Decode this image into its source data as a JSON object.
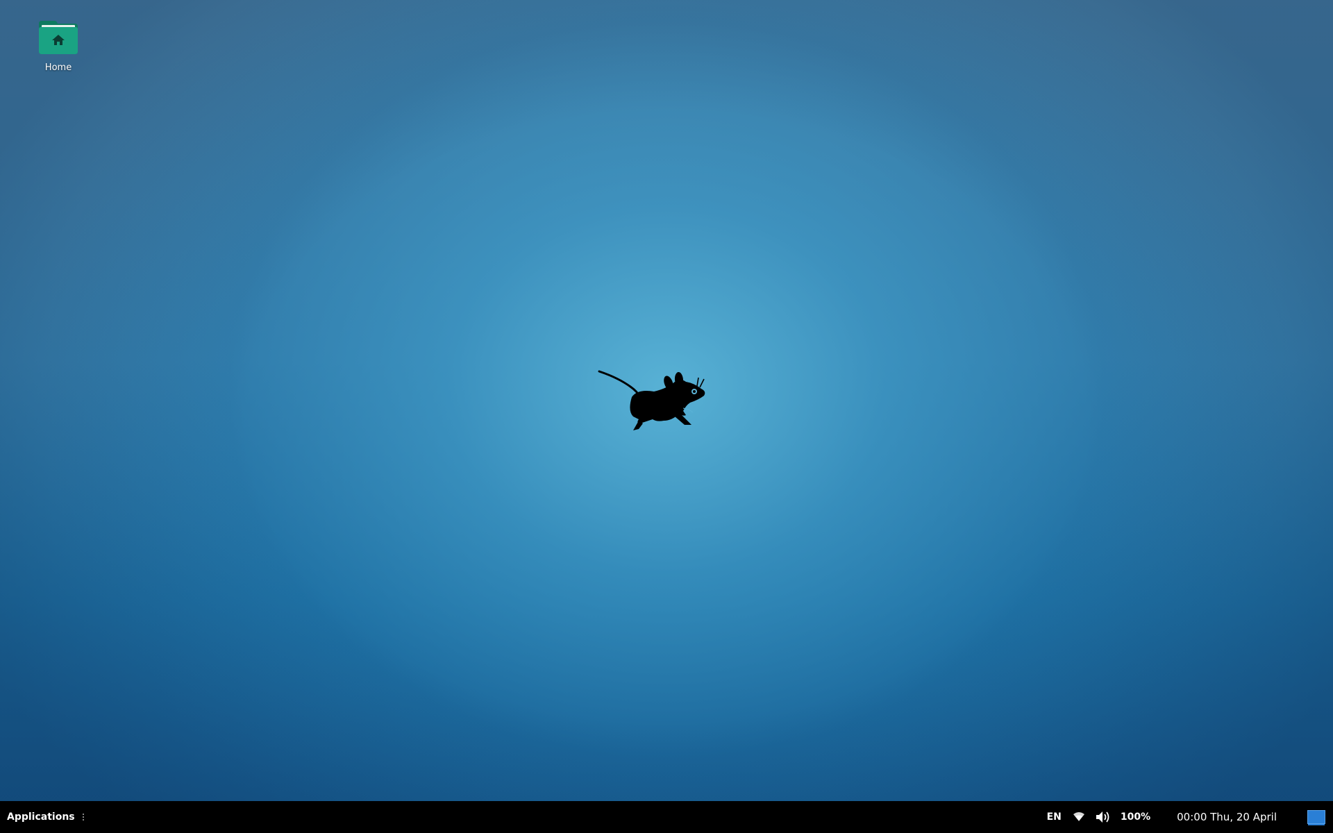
{
  "desktop": {
    "icons": [
      {
        "label": "Home",
        "icon": "home-folder-icon"
      }
    ],
    "wallpaper": {
      "mascot": "xfce-mouse-logo",
      "accent_center": "#5bb3d6",
      "accent_edge": "#175d92"
    }
  },
  "panel": {
    "applications_label": "Applications",
    "keyboard_layout": "EN",
    "network_icon": "wifi-icon",
    "volume_icon": "speaker-icon",
    "battery_text": "100%",
    "clock": "00:00 Thu, 20 April",
    "show_desktop_icon": "show-desktop-icon",
    "colors": {
      "background": "#000000",
      "text": "#ffffff",
      "show_desktop": "#2a7fd6"
    }
  }
}
